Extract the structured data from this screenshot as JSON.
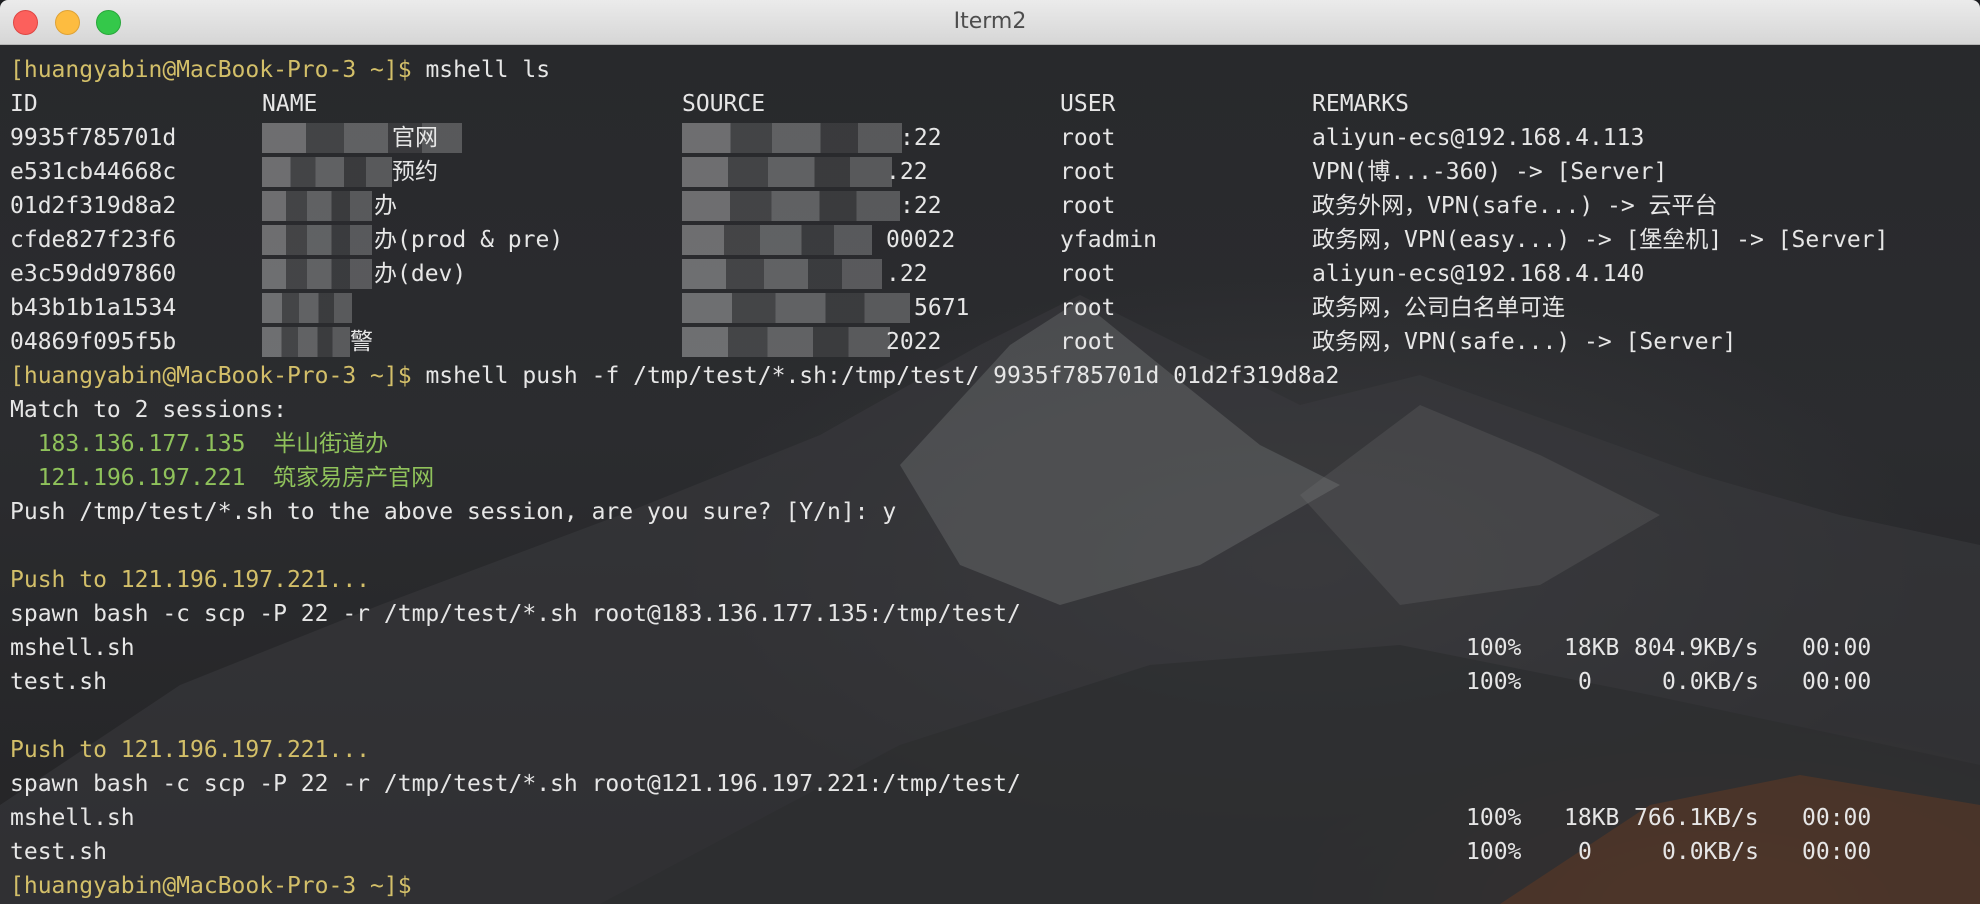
{
  "window": {
    "title": "Iterm2"
  },
  "prompt": "[huangyabin@MacBook-Pro-3 ~]$",
  "commands": {
    "ls": "mshell ls",
    "push": "mshell push -f /tmp/test/*.sh:/tmp/test/ 9935f785701d 01d2f319d8a2"
  },
  "table": {
    "headers": [
      "ID",
      "NAME",
      "SOURCE",
      "USER",
      "REMARKS"
    ],
    "rows": [
      {
        "id": "9935f785701d",
        "name": "官网",
        "source": ":22",
        "user": "root",
        "remarks": "aliyun-ecs@192.168.4.113"
      },
      {
        "id": "e531cb44668c",
        "name": "预约",
        "source": ".22",
        "user": "root",
        "remarks": "VPN(博...-360) -> [Server]"
      },
      {
        "id": "01d2f319d8a2",
        "name": "办",
        "source": ":22",
        "user": "root",
        "remarks": "政务外网，VPN(safe...) -> 云平台"
      },
      {
        "id": "cfde827f23f6",
        "name": "办(prod & pre)",
        "source": "00022",
        "user": "yfadmin",
        "remarks": "政务网，VPN(easy...) -> [堡垒机] -> [Server]"
      },
      {
        "id": "e3c59dd97860",
        "name": "办(dev)",
        "source": ".22",
        "user": "root",
        "remarks": "aliyun-ecs@192.168.4.140"
      },
      {
        "id": "b43b1b1a1534",
        "name": "",
        "source": "5671",
        "user": "root",
        "remarks": "政务网，公司白名单可连"
      },
      {
        "id": "04869f095f5b",
        "name": "警",
        "source": "2022",
        "user": "root",
        "remarks": "政务网，VPN(safe...) -> [Server]"
      }
    ]
  },
  "match": {
    "header": "Match to 2 sessions:",
    "sessions": [
      {
        "ip": "183.136.177.135",
        "name": "半山街道办"
      },
      {
        "ip": "121.196.197.221",
        "name": "筑家易房产官网"
      }
    ]
  },
  "confirm": "Push /tmp/test/*.sh to the above session, are you sure? [Y/n]: y",
  "pushes": [
    {
      "title": "Push to 121.196.197.221...",
      "spawn": "spawn bash -c scp -P 22 -r /tmp/test/*.sh root@183.136.177.135:/tmp/test/",
      "files": [
        {
          "name": "mshell.sh",
          "percent": "100%",
          "size": "18KB",
          "speed": "804.9KB/s",
          "time": "00:00"
        },
        {
          "name": "test.sh",
          "percent": "100%",
          "size": "0",
          "speed": "0.0KB/s",
          "time": "00:00"
        }
      ]
    },
    {
      "title": "Push to 121.196.197.221...",
      "spawn": "spawn bash -c scp -P 22 -r /tmp/test/*.sh root@121.196.197.221:/tmp/test/",
      "files": [
        {
          "name": "mshell.sh",
          "percent": "100%",
          "size": "18KB",
          "speed": "766.1KB/s",
          "time": "00:00"
        },
        {
          "name": "test.sh",
          "percent": "100%",
          "size": "0",
          "speed": "0.0KB/s",
          "time": "00:00"
        }
      ]
    }
  ]
}
